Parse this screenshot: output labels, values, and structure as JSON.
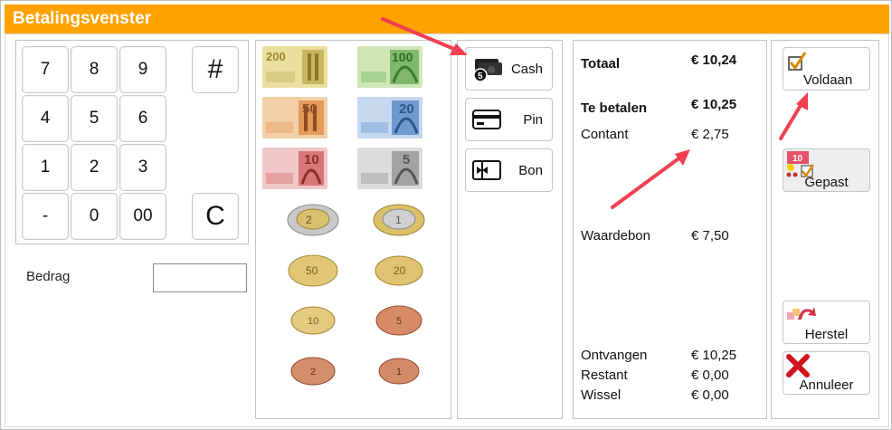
{
  "window": {
    "title": "Betalingsvenster"
  },
  "keypad": {
    "keys": [
      "7",
      "8",
      "9",
      "#",
      "4",
      "5",
      "6",
      "1",
      "2",
      "3",
      "-",
      "0",
      "00",
      "C"
    ]
  },
  "amount": {
    "label": "Bedrag",
    "value": ""
  },
  "money": {
    "notes": [
      "€200",
      "€100",
      "€50",
      "€20",
      "€10",
      "€5"
    ],
    "coins": [
      "€2",
      "€1",
      "50 cent",
      "20 cent",
      "10 cent",
      "5 cent",
      "2 cent",
      "1 cent"
    ]
  },
  "payment_methods": [
    {
      "label": "Cash",
      "icon": "cash-icon"
    },
    {
      "label": "Pin",
      "icon": "card-icon"
    },
    {
      "label": "Bon",
      "icon": "voucher-icon"
    }
  ],
  "summary": {
    "totaal_label": "Totaal",
    "totaal_value": "€ 10,24",
    "te_betalen_label": "Te betalen",
    "te_betalen_value": "€ 10,25",
    "contant_label": "Contant",
    "contant_value": "€ 2,75",
    "waardebon_label": "Waardebon",
    "waardebon_value": "€ 7,50",
    "ontvangen_label": "Ontvangen",
    "ontvangen_value": "€ 10,25",
    "restant_label": "Restant",
    "restant_value": "€ 0,00",
    "wissel_label": "Wissel",
    "wissel_value": "€ 0,00"
  },
  "actions": {
    "voldaan": "Voldaan",
    "gepast": "Gepast",
    "gepast_badge": "10",
    "herstel": "Herstel",
    "annuleer": "Annuleer"
  },
  "colors": {
    "titlebar": "#ffa200",
    "annotation_arrow": "#f04050"
  }
}
